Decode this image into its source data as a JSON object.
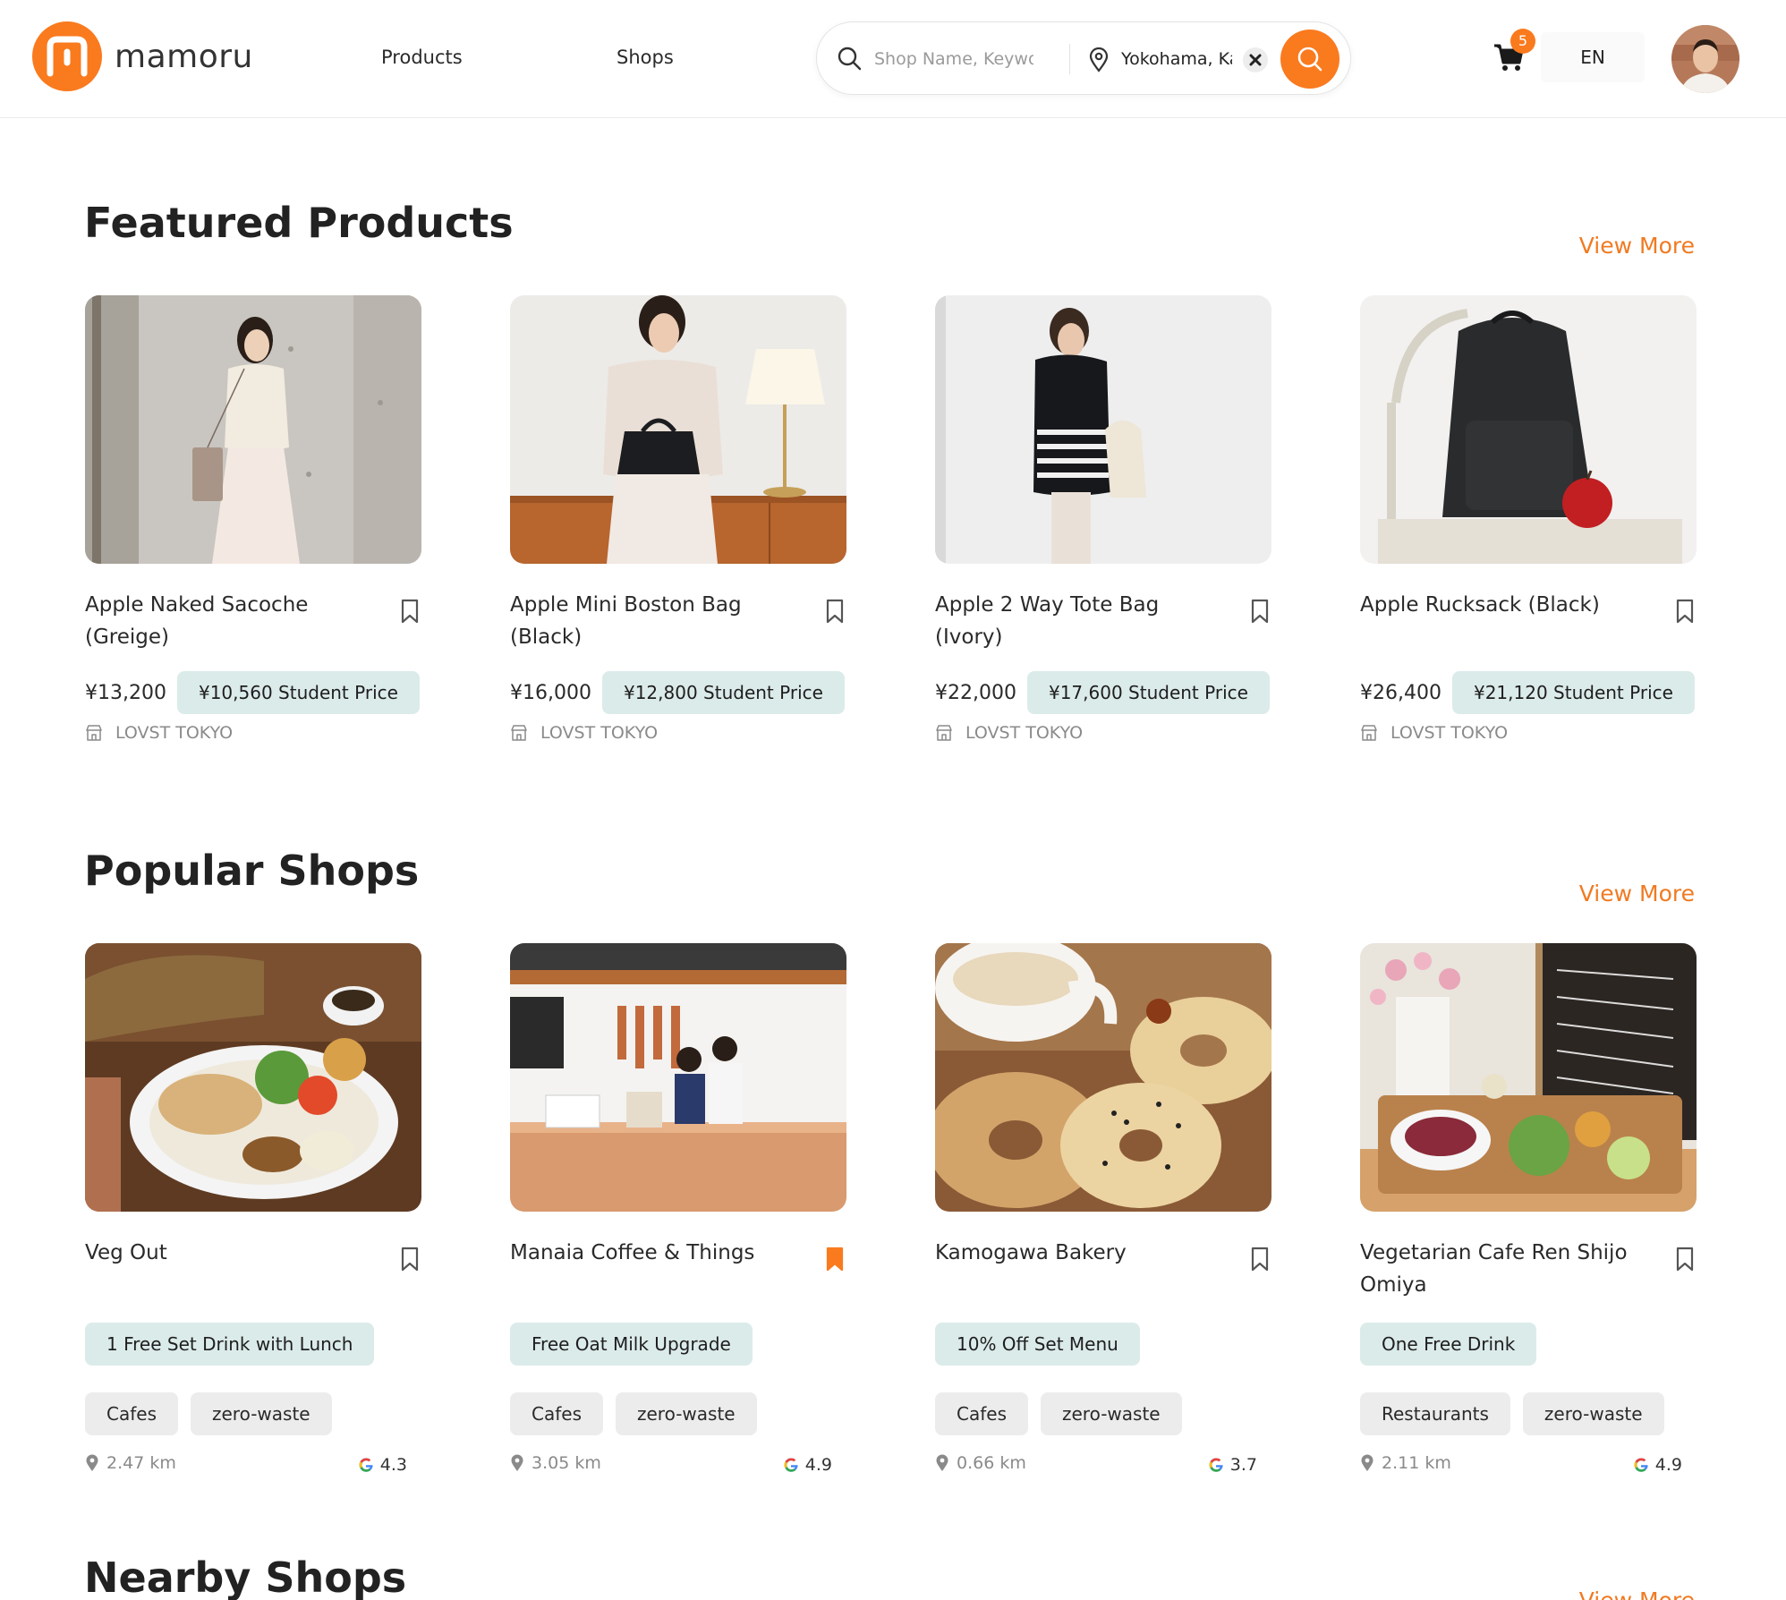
{
  "header": {
    "logo_text": "mamoru",
    "nav": {
      "products": "Products",
      "shops": "Shops"
    },
    "search": {
      "placeholder": "Shop Name, Keyword",
      "location_value": "Yokohama, Kanagawa"
    },
    "cart_count": "5",
    "language": "EN"
  },
  "featured": {
    "title": "Featured Products",
    "view_more": "View More",
    "items": [
      {
        "title": "Apple Naked Sacoche (Greige)",
        "price": "¥13,200",
        "student_price": "¥10,560 Student Price",
        "shop": "LOVST TOKYO"
      },
      {
        "title": "Apple Mini Boston Bag (Black)",
        "price": "¥16,000",
        "student_price": "¥12,800 Student Price",
        "shop": "LOVST TOKYO"
      },
      {
        "title": "Apple 2 Way Tote Bag (Ivory)",
        "price": "¥22,000",
        "student_price": "¥17,600 Student Price",
        "shop": "LOVST TOKYO"
      },
      {
        "title": "Apple Rucksack (Black)",
        "price": "¥26,400",
        "student_price": "¥21,120 Student Price",
        "shop": "LOVST TOKYO"
      }
    ]
  },
  "popular": {
    "title": "Popular Shops",
    "view_more": "View More",
    "items": [
      {
        "name": "Veg Out",
        "offer": "1 Free Set Drink with Lunch",
        "tags": [
          "Cafes",
          "zero-waste"
        ],
        "distance": "2.47 km",
        "rating": "4.3",
        "saved": false
      },
      {
        "name": "Manaia Coffee & Things",
        "offer": "Free Oat Milk Upgrade",
        "tags": [
          "Cafes",
          "zero-waste"
        ],
        "distance": "3.05 km",
        "rating": "4.9",
        "saved": true
      },
      {
        "name": "Kamogawa Bakery",
        "offer": "10% Off Set Menu",
        "tags": [
          "Cafes",
          "zero-waste"
        ],
        "distance": "0.66 km",
        "rating": "3.7",
        "saved": false
      },
      {
        "name": "Vegetarian Cafe Ren Shijo Omiya",
        "offer": "One Free Drink",
        "tags": [
          "Restaurants",
          "zero-waste"
        ],
        "distance": "2.11 km",
        "rating": "4.9",
        "saved": false
      }
    ]
  },
  "nearby": {
    "title": "Nearby Shops",
    "view_more": "View More"
  },
  "colors": {
    "accent": "#fa7a1e",
    "offer_bg": "#dbebe9",
    "tag_bg": "#ececec"
  }
}
